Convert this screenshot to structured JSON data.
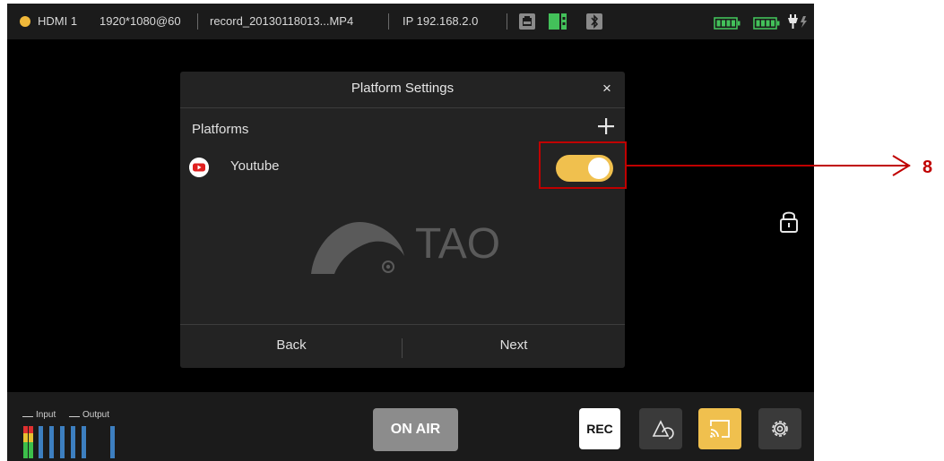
{
  "statusbar": {
    "source": "HDMI 1",
    "resolution": "1920*1080@60",
    "record_file": "record_20130118013...MP4",
    "ip": "IP 192.168.2.0",
    "indicator_color": "#f0b83a"
  },
  "dialog": {
    "title": "Platform Settings",
    "close_label": "×",
    "platforms_label": "Platforms",
    "platform_items": [
      {
        "name": "Youtube",
        "enabled": true
      }
    ],
    "logo_text": "TAO",
    "back_label": "Back",
    "next_label": "Next"
  },
  "bottombar": {
    "input_label": "Input",
    "output_label": "Output",
    "onair_label": "ON AIR",
    "rec_label": "REC"
  },
  "annotation": {
    "number": "8",
    "color": "#c00000"
  },
  "colors": {
    "accent": "#f0c04e",
    "panel": "#232323",
    "bar": "#1b1b1b"
  },
  "icons": [
    "network-icon",
    "sd-card-icon",
    "bluetooth-icon",
    "battery-icon",
    "power-plug-icon",
    "youtube-icon",
    "add-icon",
    "close-icon",
    "lock-icon",
    "shape-icon",
    "cast-icon",
    "gear-icon"
  ]
}
